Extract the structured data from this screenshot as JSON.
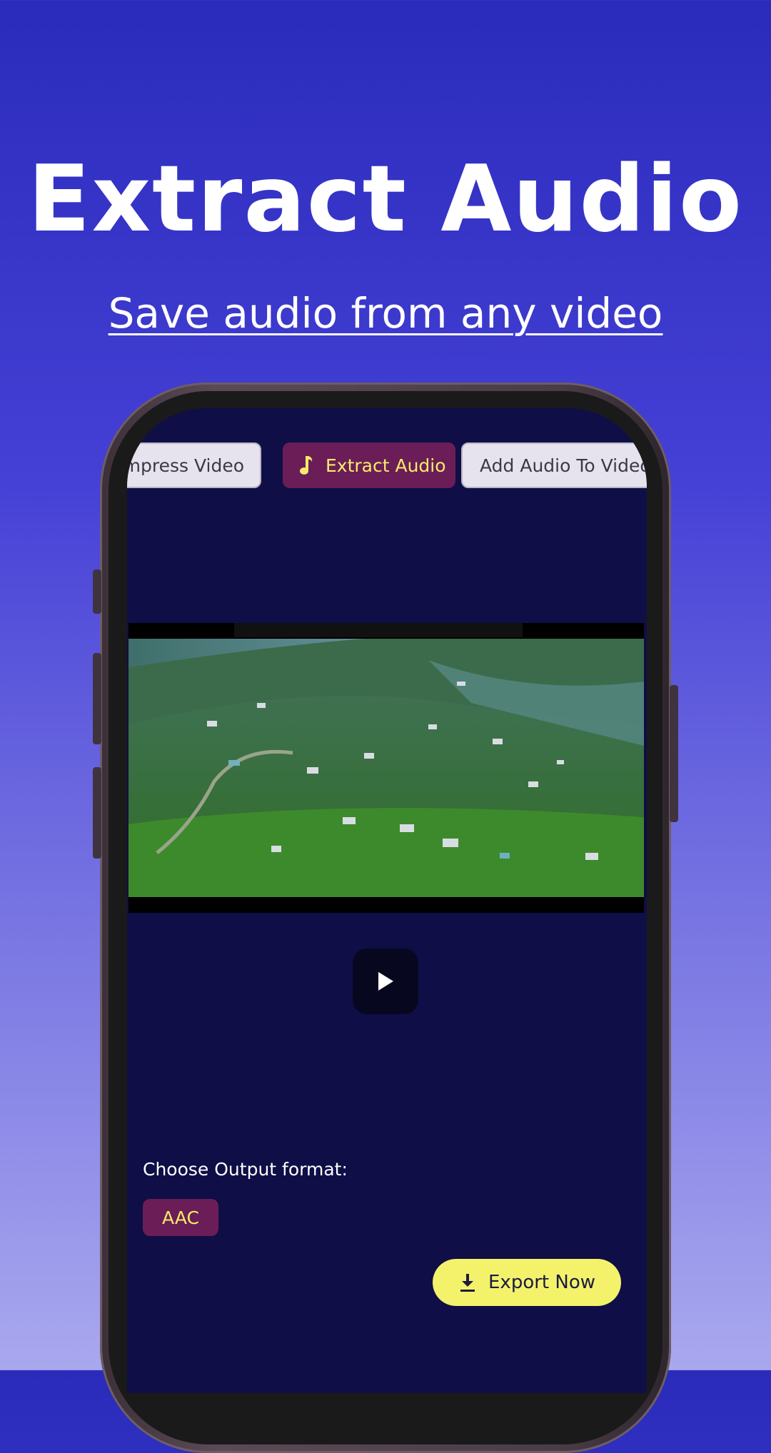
{
  "promo": {
    "headline": "Extract Audio",
    "subheadline": "Save audio from any video"
  },
  "tabs": [
    {
      "label": "Compress Video",
      "active": false
    },
    {
      "label": "Extract Audio",
      "active": true,
      "icon": "music-note-icon"
    },
    {
      "label": "Add Audio To Video",
      "active": false
    }
  ],
  "player": {
    "play_icon": "play-icon"
  },
  "output": {
    "label": "Choose Output format:",
    "selected_format": "AAC"
  },
  "export": {
    "label": "Export Now",
    "icon": "download-icon"
  },
  "colors": {
    "screen_bg": "#0f0e47",
    "active_tab_bg": "#6b1d57",
    "active_tab_text": "#f6ec6a",
    "export_bg": "#f3f26a"
  }
}
